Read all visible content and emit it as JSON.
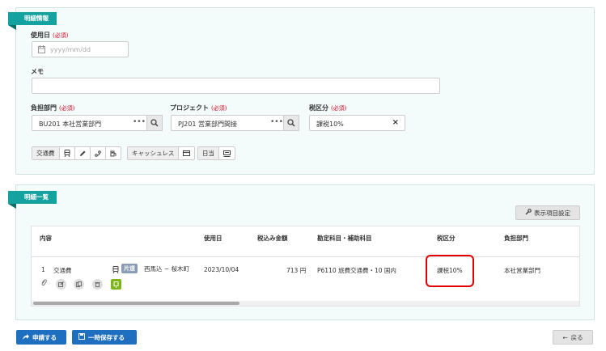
{
  "detail_info": {
    "section_title": "明細情報",
    "usage_date": {
      "label": "使用日",
      "required": "(必須)",
      "placeholder": "yyyy/mm/dd"
    },
    "memo": {
      "label": "メモ",
      "value": ""
    },
    "department": {
      "label": "負担部門",
      "required": "(必須)",
      "value": "BU201 本社営業部門"
    },
    "project": {
      "label": "プロジェクト",
      "required": "(必須)",
      "value": "PJ201 営業部門間接"
    },
    "tax": {
      "label": "税区分",
      "required": "(必須)",
      "value": "課税10%"
    },
    "buttons": {
      "transport": "交通費",
      "cashless": "キャッシュレス",
      "daily": "日当"
    }
  },
  "detail_list": {
    "section_title": "明細一覧",
    "display_settings": "表示項目設定",
    "columns": [
      "内容",
      "使用日",
      "税込み金額",
      "勘定科目・補助科目",
      "税区分",
      "負担部門"
    ],
    "rows": [
      {
        "no": "1",
        "type": "交通費",
        "badge": "片道",
        "route": "西馬込 − 桜木町",
        "date": "2023/10/04",
        "amount": "713 円",
        "account": "P6110 旅費交通費・10 国内",
        "tax": "課税10%",
        "department": "本社営業部門"
      }
    ]
  },
  "footer": {
    "apply": "申請する",
    "save_temp": "一時保存する",
    "back": "戻る"
  },
  "colors": {
    "accent": "#14a2a0",
    "primary_button": "#1e6fbf",
    "highlight_box": "#e00000"
  }
}
